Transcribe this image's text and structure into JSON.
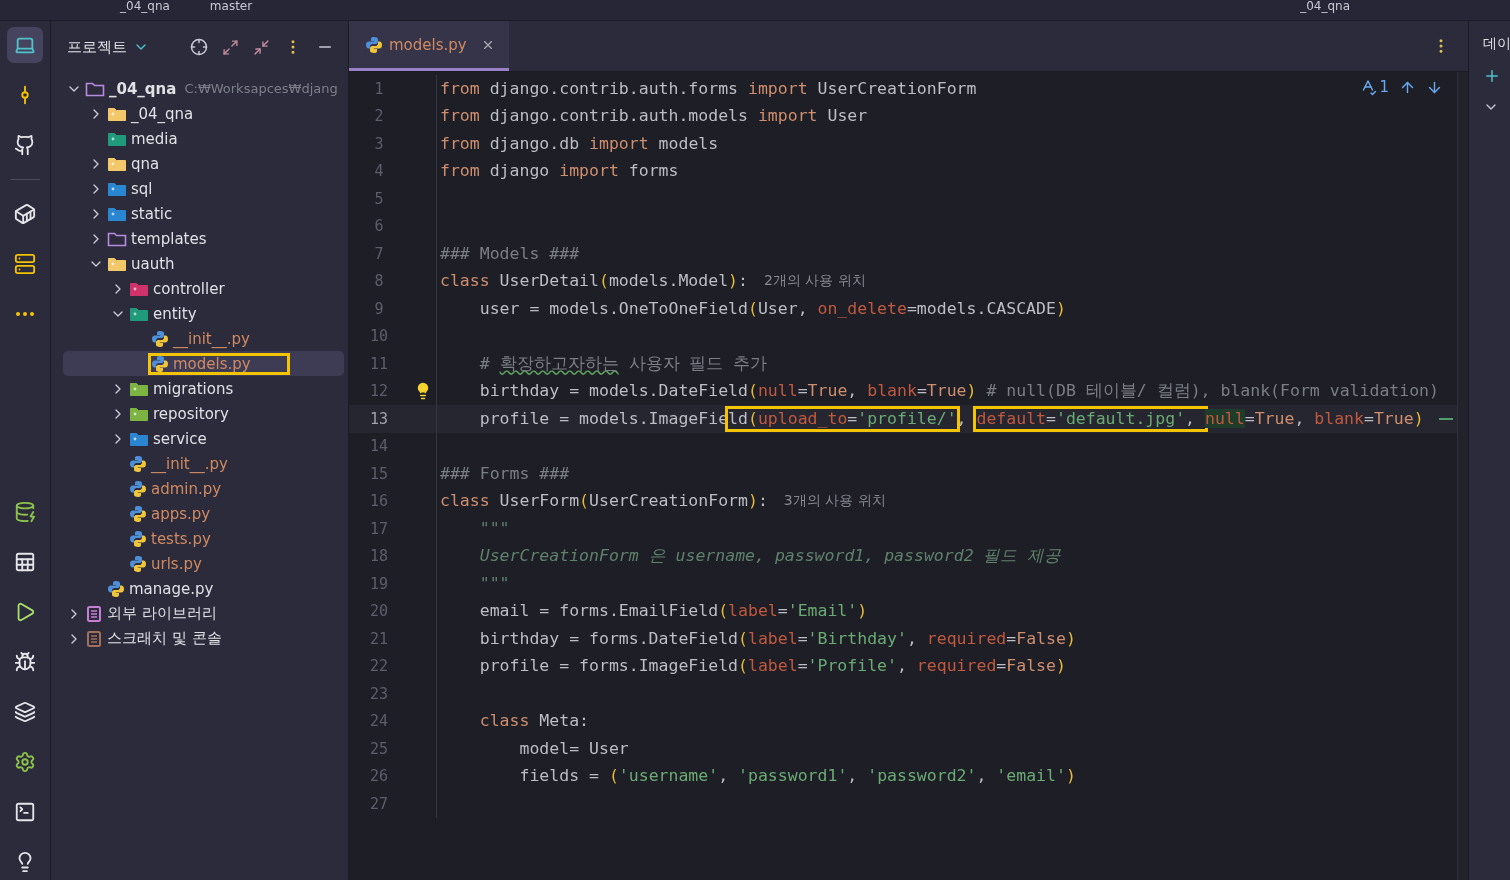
{
  "top_bar": {
    "project": "_04_qna",
    "branch": "master",
    "run_config": "_04_qna"
  },
  "toolbar": {
    "top": [
      {
        "selected": true
      },
      {
        "selected": false
      },
      {
        "selected": false
      },
      {
        "selected": false
      },
      {
        "selected": false
      },
      {
        "selected": false
      }
    ],
    "bottom": [
      {
        "selected": false
      },
      {
        "selected": false
      },
      {
        "selected": false
      },
      {
        "selected": false
      },
      {
        "selected": false
      },
      {
        "selected": false
      },
      {
        "selected": false
      },
      {
        "selected": false
      }
    ]
  },
  "project_panel": {
    "title": "프로젝트",
    "tree": [
      {
        "name": "_04_qna",
        "kind": "project",
        "path": "C:₩Worksapces₩djang",
        "expanded": true,
        "selected": false,
        "annotated": false,
        "untracked": false,
        "children": [
          {
            "name": "_04_qna",
            "kind": "folder",
            "expanded": false,
            "selected": false,
            "annotated": false,
            "untracked": false
          },
          {
            "name": "media",
            "kind": "resource",
            "selected": false,
            "annotated": false,
            "untracked": false
          },
          {
            "name": "qna",
            "kind": "folder",
            "expanded": false,
            "selected": false,
            "annotated": false,
            "untracked": false
          },
          {
            "name": "sql",
            "kind": "sql",
            "expanded": false,
            "selected": false,
            "annotated": false,
            "untracked": false
          },
          {
            "name": "static",
            "kind": "web",
            "expanded": false,
            "selected": false,
            "annotated": false,
            "untracked": false
          },
          {
            "name": "templates",
            "kind": "template",
            "expanded": false,
            "selected": false,
            "annotated": false,
            "untracked": false
          },
          {
            "name": "uauth",
            "kind": "folder",
            "expanded": true,
            "selected": false,
            "annotated": false,
            "untracked": false,
            "children": [
              {
                "name": "controller",
                "kind": "controller",
                "expanded": false,
                "selected": false,
                "annotated": false,
                "untracked": false
              },
              {
                "name": "entity",
                "kind": "entity",
                "expanded": true,
                "selected": false,
                "annotated": false,
                "untracked": false,
                "children": [
                  {
                    "name": "__init__.py",
                    "kind": "python",
                    "selected": false,
                    "annotated": false,
                    "untracked": true
                  },
                  {
                    "name": "models.py",
                    "kind": "python",
                    "selected": true,
                    "annotated": true,
                    "untracked": true
                  }
                ]
              },
              {
                "name": "migrations",
                "kind": "db",
                "expanded": false,
                "selected": false,
                "annotated": false,
                "untracked": false
              },
              {
                "name": "repository",
                "kind": "db",
                "expanded": false,
                "selected": false,
                "annotated": false,
                "untracked": false
              },
              {
                "name": "service",
                "kind": "sigma",
                "expanded": false,
                "selected": false,
                "annotated": false,
                "untracked": false
              },
              {
                "name": "__init__.py",
                "kind": "python",
                "selected": false,
                "annotated": false,
                "untracked": true
              },
              {
                "name": "admin.py",
                "kind": "python",
                "selected": false,
                "annotated": false,
                "untracked": true
              },
              {
                "name": "apps.py",
                "kind": "python",
                "selected": false,
                "annotated": false,
                "untracked": true
              },
              {
                "name": "tests.py",
                "kind": "python",
                "selected": false,
                "annotated": false,
                "untracked": true
              },
              {
                "name": "urls.py",
                "kind": "python",
                "selected": false,
                "annotated": false,
                "untracked": true
              }
            ]
          },
          {
            "name": "manage.py",
            "kind": "python",
            "selected": false,
            "annotated": false,
            "untracked": false
          }
        ]
      },
      {
        "name": "외부 라이브러리",
        "kind": "library",
        "expanded": false,
        "selected": false,
        "annotated": false,
        "untracked": false
      },
      {
        "name": "스크래치 및 콘솔",
        "kind": "scratch",
        "expanded": false,
        "selected": false,
        "annotated": false,
        "untracked": false
      }
    ]
  },
  "editor": {
    "tabs": [
      {
        "label": "models.py",
        "untracked": true,
        "selected": true
      }
    ],
    "inspections": {
      "count": "1"
    },
    "lines": [
      {
        "number": "1",
        "tokens": [
          {
            "kind": "kw",
            "text": "from"
          },
          {
            "kind": "plain",
            "text": " django.contrib.auth.forms "
          },
          {
            "kind": "kw",
            "text": "import"
          },
          {
            "kind": "plain",
            "text": " UserCreationForm"
          }
        ]
      },
      {
        "number": "2",
        "tokens": [
          {
            "kind": "kw",
            "text": "from"
          },
          {
            "kind": "plain",
            "text": " django.contrib.auth.models "
          },
          {
            "kind": "kw",
            "text": "import"
          },
          {
            "kind": "plain",
            "text": " User"
          }
        ]
      },
      {
        "number": "3",
        "tokens": [
          {
            "kind": "kw",
            "text": "from"
          },
          {
            "kind": "plain",
            "text": " django.db "
          },
          {
            "kind": "kw",
            "text": "import"
          },
          {
            "kind": "plain",
            "text": " models"
          }
        ]
      },
      {
        "number": "4",
        "tokens": [
          {
            "kind": "kw",
            "text": "from"
          },
          {
            "kind": "plain",
            "text": " django "
          },
          {
            "kind": "kw",
            "text": "import"
          },
          {
            "kind": "plain",
            "text": " forms"
          }
        ]
      },
      {
        "number": "5"
      },
      {
        "number": "6"
      },
      {
        "number": "7",
        "tokens": [
          {
            "kind": "comment",
            "text": "### Models ###"
          }
        ]
      },
      {
        "number": "8",
        "tokens": [
          {
            "kind": "kw",
            "text": "class"
          },
          {
            "kind": "plain",
            "text": " UserDetail"
          },
          {
            "kind": "paren",
            "text": "("
          },
          {
            "kind": "plain",
            "text": "models.Model"
          },
          {
            "kind": "paren",
            "text": ")"
          },
          {
            "kind": "plain",
            "text": ":"
          }
        ],
        "hint": "2개의 사용 위치"
      },
      {
        "number": "9",
        "tokens": [
          {
            "kind": "plain",
            "text": "    user = models.OneToOneField"
          },
          {
            "kind": "paren",
            "text": "("
          },
          {
            "kind": "plain",
            "text": "User, "
          },
          {
            "kind": "param",
            "text": "on_delete"
          },
          {
            "kind": "plain",
            "text": "=models.CASCADE"
          },
          {
            "kind": "paren",
            "text": ")"
          }
        ]
      },
      {
        "number": "10"
      },
      {
        "number": "11",
        "tokens": [
          {
            "kind": "comment",
            "text": "    # "
          },
          {
            "kind": "typo",
            "text": "확장하고자하는"
          },
          {
            "kind": "comment",
            "text": " 사용자 필드 추가"
          }
        ]
      },
      {
        "number": "12",
        "bulb": true,
        "tokens": [
          {
            "kind": "plain",
            "text": "    birthday = models.DateField"
          },
          {
            "kind": "paren",
            "text": "("
          },
          {
            "kind": "param",
            "text": "null"
          },
          {
            "kind": "plain",
            "text": "="
          },
          {
            "kind": "kw",
            "text": "True"
          },
          {
            "kind": "plain",
            "text": ", "
          },
          {
            "kind": "param",
            "text": "blank"
          },
          {
            "kind": "plain",
            "text": "="
          },
          {
            "kind": "kw",
            "text": "True"
          },
          {
            "kind": "paren",
            "text": ")"
          },
          {
            "kind": "comment",
            "text": " # null(DB 테이블/ 컬럼), blank(Form validation)"
          }
        ]
      },
      {
        "number": "13",
        "current": true,
        "changed": true,
        "segments": [
          {
            "boxed": false,
            "tokens": [
              {
                "kind": "plain",
                "text": "    profile = models.ImageFie"
              }
            ]
          },
          {
            "boxed": true,
            "tokens": [
              {
                "kind": "plain",
                "text": "ld"
              },
              {
                "kind": "paren",
                "text": "("
              },
              {
                "kind": "param",
                "text": "upload_to"
              },
              {
                "kind": "plain",
                "text": "="
              },
              {
                "kind": "str",
                "text": "'profile/'"
              }
            ]
          },
          {
            "boxed": false,
            "tokens": [
              {
                "kind": "plain",
                "text": ", "
              }
            ]
          },
          {
            "boxed": true,
            "tokens": [
              {
                "kind": "param",
                "text": "default"
              },
              {
                "kind": "plain",
                "text": "="
              },
              {
                "kind": "str",
                "text": "'default.jpg'"
              },
              {
                "kind": "plain",
                "text": ", "
              }
            ]
          },
          {
            "boxed": false,
            "tokens": [
              {
                "kind": "marked",
                "text": "null"
              },
              {
                "kind": "plain",
                "text": "="
              },
              {
                "kind": "kw",
                "text": "True"
              },
              {
                "kind": "plain",
                "text": ", "
              },
              {
                "kind": "param",
                "text": "blank"
              },
              {
                "kind": "plain",
                "text": "="
              },
              {
                "kind": "kw",
                "text": "True"
              },
              {
                "kind": "paren",
                "text": ")"
              }
            ]
          }
        ]
      },
      {
        "number": "14"
      },
      {
        "number": "15",
        "tokens": [
          {
            "kind": "comment",
            "text": "### Forms ###"
          }
        ]
      },
      {
        "number": "16",
        "tokens": [
          {
            "kind": "kw",
            "text": "class"
          },
          {
            "kind": "plain",
            "text": " UserForm"
          },
          {
            "kind": "paren",
            "text": "("
          },
          {
            "kind": "plain",
            "text": "UserCreationForm"
          },
          {
            "kind": "paren",
            "text": ")"
          },
          {
            "kind": "plain",
            "text": ":"
          }
        ],
        "hint": "3개의 사용 위치"
      },
      {
        "number": "17",
        "tokens": [
          {
            "kind": "doc",
            "text": "    \"\"\""
          }
        ]
      },
      {
        "number": "18",
        "tokens": [
          {
            "kind": "doc",
            "text": "    UserCreationForm 은 username, password1, password2 필드 제공"
          }
        ]
      },
      {
        "number": "19",
        "tokens": [
          {
            "kind": "doc",
            "text": "    \"\"\""
          }
        ]
      },
      {
        "number": "20",
        "tokens": [
          {
            "kind": "plain",
            "text": "    email = forms.EmailField"
          },
          {
            "kind": "paren",
            "text": "("
          },
          {
            "kind": "param",
            "text": "label"
          },
          {
            "kind": "plain",
            "text": "="
          },
          {
            "kind": "str",
            "text": "'Email'"
          },
          {
            "kind": "paren",
            "text": ")"
          }
        ]
      },
      {
        "number": "21",
        "tokens": [
          {
            "kind": "plain",
            "text": "    birthday = forms.DateField"
          },
          {
            "kind": "paren",
            "text": "("
          },
          {
            "kind": "param",
            "text": "label"
          },
          {
            "kind": "plain",
            "text": "="
          },
          {
            "kind": "str",
            "text": "'Birthday'"
          },
          {
            "kind": "plain",
            "text": ", "
          },
          {
            "kind": "param",
            "text": "required"
          },
          {
            "kind": "plain",
            "text": "="
          },
          {
            "kind": "kw",
            "text": "False"
          },
          {
            "kind": "paren",
            "text": ")"
          }
        ]
      },
      {
        "number": "22",
        "tokens": [
          {
            "kind": "plain",
            "text": "    profile = forms.ImageField"
          },
          {
            "kind": "paren",
            "text": "("
          },
          {
            "kind": "param",
            "text": "label"
          },
          {
            "kind": "plain",
            "text": "="
          },
          {
            "kind": "str",
            "text": "'Profile'"
          },
          {
            "kind": "plain",
            "text": ", "
          },
          {
            "kind": "param",
            "text": "required"
          },
          {
            "kind": "plain",
            "text": "="
          },
          {
            "kind": "kw",
            "text": "False"
          },
          {
            "kind": "paren",
            "text": ")"
          }
        ]
      },
      {
        "number": "23"
      },
      {
        "number": "24",
        "tokens": [
          {
            "kind": "kw",
            "text": "    class"
          },
          {
            "kind": "plain",
            "text": " Meta:"
          }
        ]
      },
      {
        "number": "25",
        "tokens": [
          {
            "kind": "plain",
            "text": "        model= User"
          }
        ]
      },
      {
        "number": "26",
        "tokens": [
          {
            "kind": "plain",
            "text": "        fields = "
          },
          {
            "kind": "paren",
            "text": "("
          },
          {
            "kind": "str",
            "text": "'username'"
          },
          {
            "kind": "plain",
            "text": ", "
          },
          {
            "kind": "str",
            "text": "'password1'"
          },
          {
            "kind": "plain",
            "text": ", "
          },
          {
            "kind": "str",
            "text": "'password2'"
          },
          {
            "kind": "plain",
            "text": ", "
          },
          {
            "kind": "str",
            "text": "'email'"
          },
          {
            "kind": "paren",
            "text": ")"
          }
        ]
      },
      {
        "number": "27"
      }
    ]
  },
  "right_panel": {
    "title": "데이"
  }
}
